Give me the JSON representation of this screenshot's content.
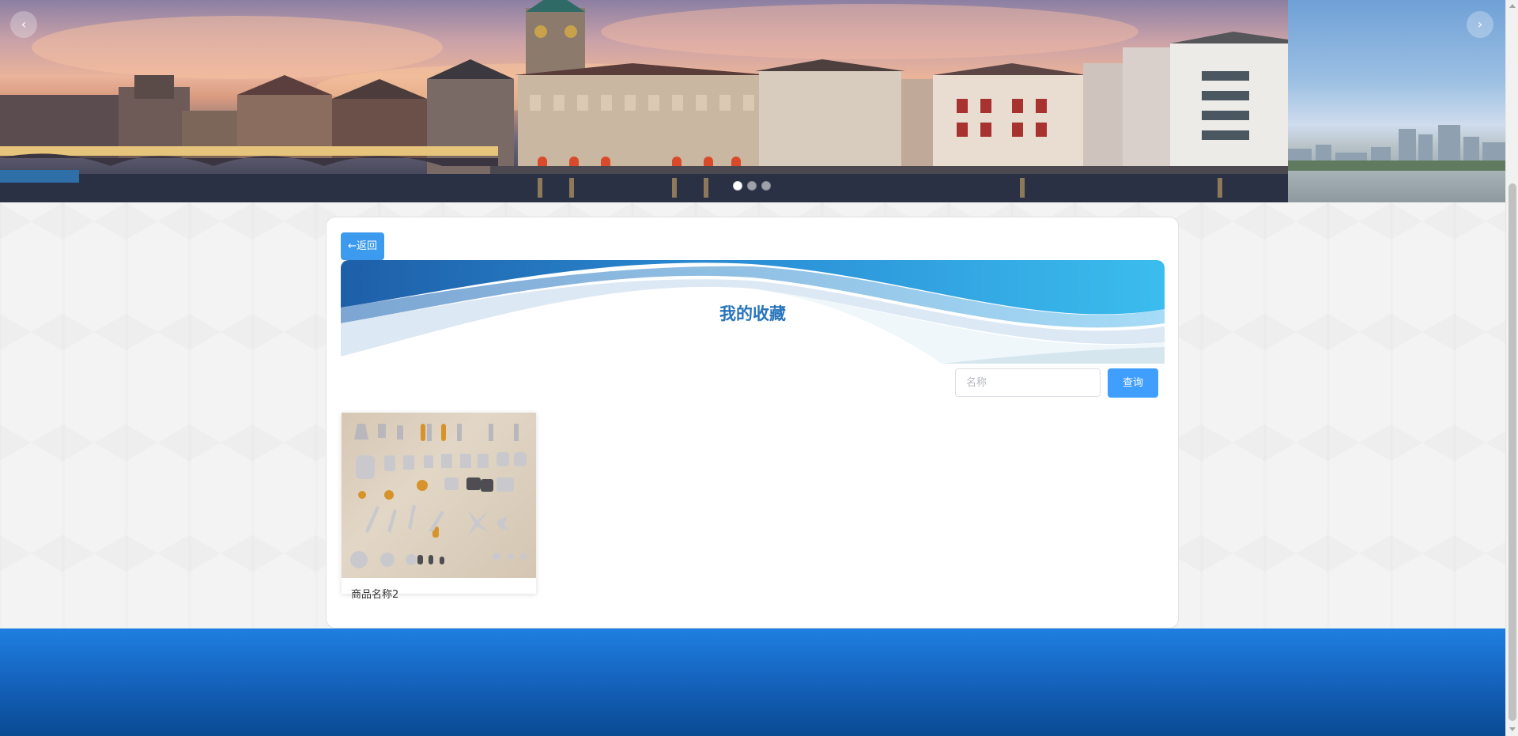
{
  "carousel": {
    "prev_icon": "chevron-left-icon",
    "next_icon": "chevron-right-icon",
    "prev_glyph": "‹",
    "next_glyph": "›",
    "dot_count": 3,
    "active_index": 0
  },
  "panel": {
    "back_label": "←返回",
    "title": "我的收藏",
    "search": {
      "placeholder": "名称",
      "value": "",
      "button_label": "查询"
    },
    "items": [
      {
        "name": "商品名称2"
      }
    ]
  },
  "colors": {
    "accent": "#409eff",
    "title": "#2674bd",
    "footer": "#1565c0"
  }
}
